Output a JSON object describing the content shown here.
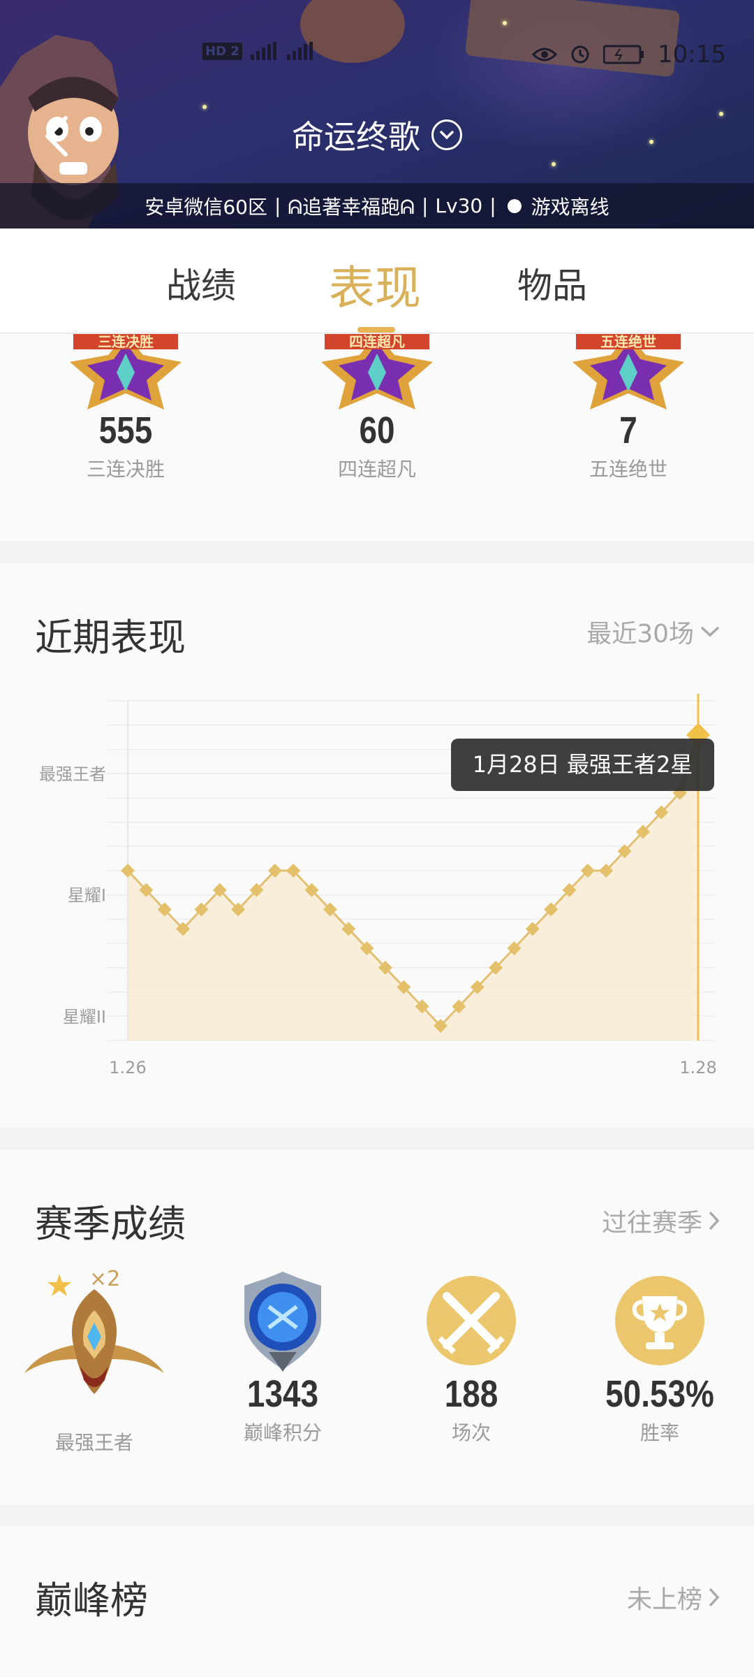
{
  "status_bar": {
    "network": "HD 2",
    "net_types": [
      "4G",
      "4G"
    ],
    "time": "10:15"
  },
  "header": {
    "title": "命运终歌",
    "info": {
      "server": "安卓微信60区",
      "player": "ᕱ追著幸福跑ᕱ",
      "level": "Lv30",
      "status": "游戏离线"
    }
  },
  "tabs": [
    {
      "label": "战绩",
      "active": false
    },
    {
      "label": "表现",
      "active": true
    },
    {
      "label": "物品",
      "active": false
    }
  ],
  "medals": [
    {
      "banner": "三连决胜",
      "count": "555",
      "label": "三连决胜"
    },
    {
      "banner": "四连超凡",
      "count": "60",
      "label": "四连超凡"
    },
    {
      "banner": "五连绝世",
      "count": "7",
      "label": "五连绝世"
    }
  ],
  "recent": {
    "title": "近期表现",
    "filter": "最近30场"
  },
  "chart_data": {
    "type": "line",
    "x_tick_labels": [
      "1.26",
      "1.28"
    ],
    "y_tick_labels": [
      "星耀II",
      "星耀I",
      "最强王者"
    ],
    "ylim": [
      0,
      14
    ],
    "y_ticks": [
      1,
      6,
      11
    ],
    "values": [
      7,
      6.2,
      5.4,
      4.6,
      5.4,
      6.2,
      5.4,
      6.2,
      7,
      7,
      6.2,
      5.4,
      4.6,
      3.8,
      3,
      2.2,
      1.4,
      0.6,
      1.4,
      2.2,
      3,
      3.8,
      4.6,
      5.4,
      6.2,
      7,
      7,
      7.8,
      8.6,
      9.4,
      10.2,
      12.6
    ],
    "highlight_index": 31,
    "tooltip": "1月28日 最强王者2星",
    "colors": {
      "line": "#e2bf72",
      "fill": "#f7ebd4",
      "marker": "#e5c06a",
      "highlight": "#f0c049"
    }
  },
  "season": {
    "title": "赛季成绩",
    "link": "过往赛季",
    "stars": "×2",
    "items": [
      {
        "value": "",
        "label": "最强王者",
        "icon": "king-rank-emblem-icon"
      },
      {
        "value": "1343",
        "label": "巅峰积分",
        "icon": "peak-score-icon"
      },
      {
        "value": "188",
        "label": "场次",
        "icon": "crossed-swords-icon"
      },
      {
        "value": "50.53%",
        "label": "胜率",
        "icon": "trophy-icon"
      }
    ]
  },
  "peak": {
    "title": "巅峰榜",
    "link": "未上榜"
  },
  "theme": {
    "accent": "#d8b15a",
    "accent_bright": "#e9b352",
    "header_bg": "#2c2f6e"
  }
}
